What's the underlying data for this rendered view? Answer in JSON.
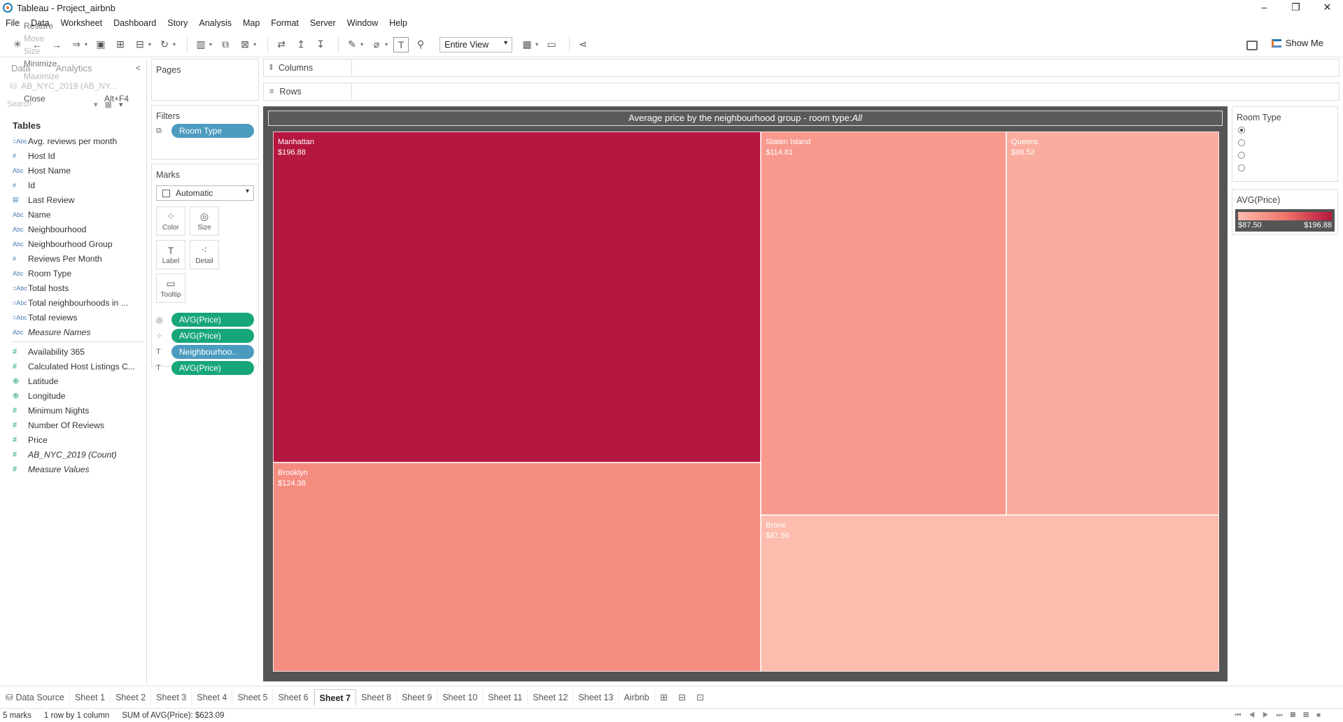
{
  "window": {
    "title": "Tableau - Project_airbnb",
    "minimize": "–",
    "restore": "❐",
    "close": "✕"
  },
  "menu": [
    "File",
    "Data",
    "Worksheet",
    "Dashboard",
    "Story",
    "Analysis",
    "Map",
    "Format",
    "Server",
    "Window",
    "Help"
  ],
  "sysmenu": {
    "restore": "Restore",
    "move": "Move",
    "size": "Size",
    "minimize": "Minimize",
    "maximize": "Maximize",
    "close": "Close",
    "close_shortcut": "Alt+F4"
  },
  "toolbar": {
    "fit": "Entire View",
    "show_me": "Show Me"
  },
  "datapane": {
    "tab_data": "Data",
    "tab_analytics": "Analytics",
    "source": "AB_NYC_2019 (AB_NY...",
    "search_placeholder": "Search",
    "tables_label": "Tables",
    "dimensions": [
      {
        "icon": "=Abc",
        "name": "Avg. reviews per month",
        "type": "calc-dim"
      },
      {
        "icon": "#",
        "name": "Host Id",
        "type": "dim-num"
      },
      {
        "icon": "Abc",
        "name": "Host Name",
        "type": "dim"
      },
      {
        "icon": "#",
        "name": "Id",
        "type": "dim-num"
      },
      {
        "icon": "▤",
        "name": "Last Review",
        "type": "dim-date"
      },
      {
        "icon": "Abc",
        "name": "Name",
        "type": "dim"
      },
      {
        "icon": "Abc",
        "name": "Neighbourhood",
        "type": "dim"
      },
      {
        "icon": "Abc",
        "name": "Neighbourhood Group",
        "type": "dim"
      },
      {
        "icon": "#",
        "name": "Reviews Per Month",
        "type": "dim-num"
      },
      {
        "icon": "Abc",
        "name": "Room Type",
        "type": "dim"
      },
      {
        "icon": "=Abc",
        "name": "Total hosts",
        "type": "calc-dim"
      },
      {
        "icon": "=Abc",
        "name": "Total neighbourhoods in ...",
        "type": "calc-dim"
      },
      {
        "icon": "=Abc",
        "name": "Total reviews",
        "type": "calc-dim"
      },
      {
        "icon": "Abc",
        "name": "Measure Names",
        "type": "dim-italic"
      }
    ],
    "measures": [
      {
        "icon": "#",
        "name": "Availability 365",
        "type": "measure"
      },
      {
        "icon": "#",
        "name": "Calculated Host Listings C...",
        "type": "measure"
      },
      {
        "icon": "⊕",
        "name": "Latitude",
        "type": "geo"
      },
      {
        "icon": "⊕",
        "name": "Longitude",
        "type": "geo"
      },
      {
        "icon": "#",
        "name": "Minimum Nights",
        "type": "measure"
      },
      {
        "icon": "#",
        "name": "Number Of Reviews",
        "type": "measure"
      },
      {
        "icon": "#",
        "name": "Price",
        "type": "measure"
      },
      {
        "icon": "#",
        "name": "AB_NYC_2019 (Count)",
        "type": "measure-italic"
      },
      {
        "icon": "#",
        "name": "Measure Values",
        "type": "measure-italic"
      }
    ]
  },
  "pages": {
    "title": "Pages"
  },
  "filters": {
    "title": "Filters",
    "pill": "Room Type"
  },
  "marks": {
    "title": "Marks",
    "type": "Automatic",
    "buttons": [
      {
        "glyph": "⁘",
        "label": "Color",
        "name": "color"
      },
      {
        "glyph": "◎",
        "label": "Size",
        "name": "size"
      },
      {
        "glyph": "T",
        "label": "Label",
        "name": "label"
      },
      {
        "glyph": "⁖",
        "label": "Detail",
        "name": "detail"
      },
      {
        "glyph": "▭",
        "label": "Tooltip",
        "name": "tooltip"
      }
    ],
    "fields": [
      {
        "icon": "◎",
        "pill": "AVG(Price)",
        "color": "green"
      },
      {
        "icon": "⁘",
        "pill": "AVG(Price)",
        "color": "green"
      },
      {
        "icon": "T",
        "pill": "Neighbourhoo..",
        "color": "blue"
      },
      {
        "icon": "T",
        "pill": "AVG(Price)",
        "color": "green"
      }
    ]
  },
  "shelves": {
    "columns": "Columns",
    "rows": "Rows"
  },
  "view": {
    "title_prefix": "Average price by the neighbourhood group - room type:",
    "title_value": "All"
  },
  "chart_data": {
    "type": "treemap",
    "title": "Average price by the neighbourhood group - room type:All",
    "measure": "AVG(Price)",
    "items": [
      {
        "name": "Manhattan",
        "value": 196.88,
        "label": "$196.88"
      },
      {
        "name": "Brooklyn",
        "value": 124.38,
        "label": "$124.38"
      },
      {
        "name": "Staten Island",
        "value": 114.81,
        "label": "$114.81"
      },
      {
        "name": "Queens",
        "value": 99.52,
        "label": "$99.52"
      },
      {
        "name": "Bronx",
        "value": 87.5,
        "label": "$87.50"
      }
    ],
    "color_scale": {
      "min": 87.5,
      "max": 196.88,
      "min_color": "#fdbcad",
      "max_color": "#b5173e"
    }
  },
  "room_type_filter": {
    "title": "Room Type",
    "options": [
      "",
      "",
      "",
      ""
    ],
    "selected": 0
  },
  "legend": {
    "title": "AVG(Price)",
    "min_label": "$87.50",
    "max_label": "$196.88"
  },
  "tabs": {
    "data_source": "Data Source",
    "sheets": [
      "Sheet 1",
      "Sheet 2",
      "Sheet 3",
      "Sheet 4",
      "Sheet 5",
      "Sheet 6",
      "Sheet 7",
      "Sheet 8",
      "Sheet 9",
      "Sheet 10",
      "Sheet 11",
      "Sheet 12",
      "Sheet 13",
      "Airbnb"
    ],
    "active": "Sheet 7"
  },
  "status": {
    "marks": "5 marks",
    "rows": "1 row by 1 column",
    "sum": "SUM of AVG(Price): $623.09"
  }
}
